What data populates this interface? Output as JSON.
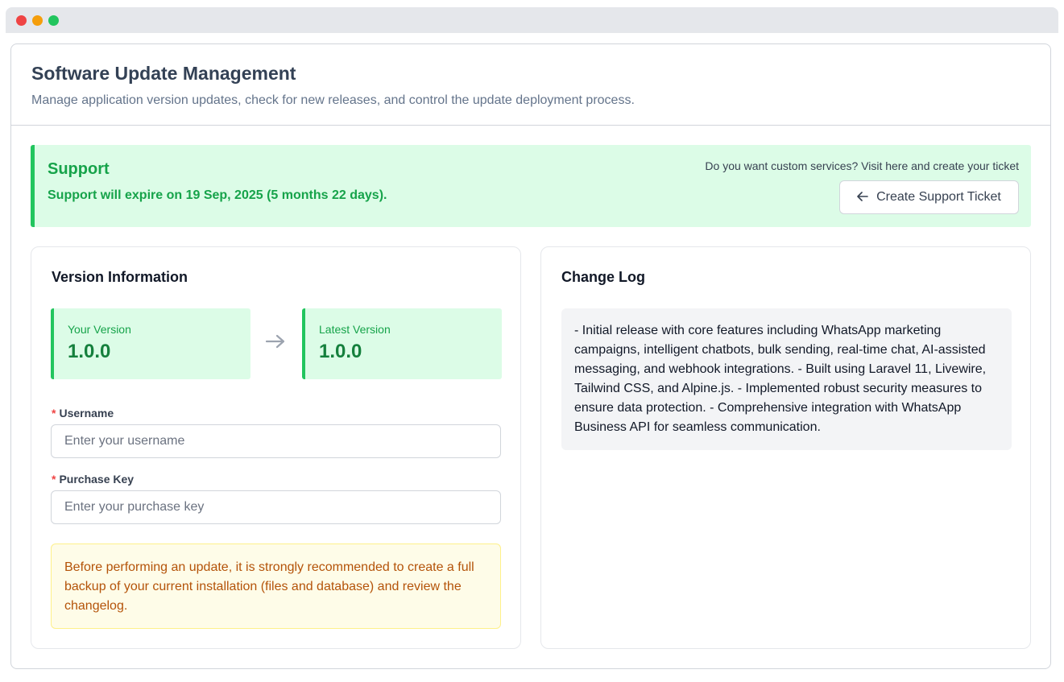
{
  "header": {
    "title": "Software Update Management",
    "subtitle": "Manage application version updates, check for new releases, and control the update deployment process."
  },
  "support": {
    "title": "Support",
    "message": "Support will expire on 19 Sep, 2025 (5 months 22 days).",
    "question": "Do you want custom services? Visit here and create your ticket",
    "button_label": "Create Support Ticket",
    "button_icon": "arrow-left-icon"
  },
  "version_info": {
    "title": "Version Information",
    "your_version_label": "Your Version",
    "your_version": "1.0.0",
    "latest_version_label": "Latest Version",
    "latest_version": "1.0.0",
    "arrow_icon": "arrow-right-icon"
  },
  "form": {
    "username_label": "Username",
    "username_placeholder": "Enter your username",
    "username_value": "",
    "purchase_key_label": "Purchase Key",
    "purchase_key_placeholder": "Enter your purchase key",
    "purchase_key_value": "",
    "required_mark": "*"
  },
  "warning": {
    "text": "Before performing an update, it is strongly recommended to create a full backup of your current installation (files and database) and review the changelog."
  },
  "changelog": {
    "title": "Change Log",
    "text": "- Initial release with core features including WhatsApp marketing campaigns, intelligent chatbots, bulk sending, real-time chat, AI-assisted messaging, and webhook integrations. - Built using Laravel 11, Livewire, Tailwind CSS, and Alpine.js. - Implemented robust security measures to ensure data protection. - Comprehensive integration with WhatsApp Business API for seamless communication."
  },
  "colors": {
    "success": "#16a34a",
    "success_bg": "#dcfce7",
    "warning_text": "#b45309",
    "warning_bg": "#fefce8",
    "required": "#ef4444"
  }
}
